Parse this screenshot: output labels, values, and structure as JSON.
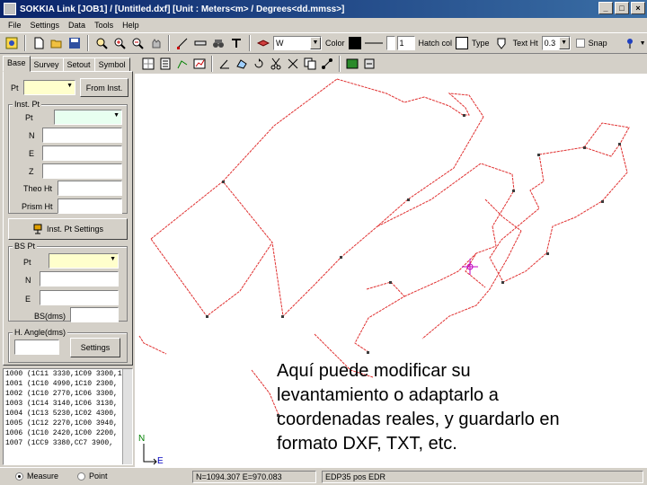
{
  "window": {
    "title": "SOKKIA Link  [JOB1] / [Untitled.dxf]  [Unit : Meters<m> / Degrees<dd.mmss>]",
    "buttons": [
      "_",
      "□",
      "×"
    ]
  },
  "menu": [
    "File",
    "Settings",
    "Data",
    "Tools",
    "Help"
  ],
  "toolbar": {
    "layer_value": "W",
    "color_label": "Color",
    "line_width_value": "1",
    "hatch_label": "Hatch col",
    "type_label": "Type",
    "text_ht_label": "Text Ht",
    "text_ht_value": "0.3",
    "snap_label": "Snap",
    "colors": {
      "color_swatch": "#000000",
      "hatch_swatch": "#ffffff"
    }
  },
  "tabs": [
    "Base",
    "Survey",
    "Setout",
    "Symbol"
  ],
  "panel": {
    "pt_label": "Pt",
    "from_inst_button": "From Inst.",
    "inst_pt_group": "Inst. Pt",
    "inst_pt_label": "Pt",
    "n_label": "N",
    "e_label": "E",
    "z_label": "Z",
    "theo_ht_label": "Theo Ht",
    "prism_ht_label": "Prism Ht",
    "inst_pt_settings_button": "Inst. Pt Settings",
    "bs_pt_group": "BS Pt",
    "bs_pt_label": "Pt",
    "bs_n_label": "N",
    "bs_e_label": "E",
    "bs_dms_label": "BS(dms)",
    "h_angle_group": "H. Angle(dms)",
    "settings_button": "Settings"
  },
  "point_list": [
    "1000  (1C11 3330,1C09 3300,1",
    "1001  (1C10 4990,1C10 2300,",
    "1002  (1C10 2770,1C06 3300,",
    "1003  (1C14 3140,1C06 3130,",
    "1004  (1C13 5230,1C02 4300,",
    "1005  (1C12 2270,1C00 3940,",
    "1006  (1C10 2420,1C00 2200,",
    "1007  (1CC9 3380,CC7 3900,"
  ],
  "axes": {
    "north": "N",
    "east": "E"
  },
  "overlay": {
    "line1": "Aquí puede modificar su",
    "line2": "levantamiento o adaptarlo a",
    "line3": "coordenadas reales, y guardarlo en",
    "line4": "formato DXF, TXT, etc."
  },
  "status": {
    "measure_label": "Measure",
    "point_label": "Point",
    "coords": "N=1094.307  E=970.083",
    "mode": "EDP35 pos EDR"
  },
  "drawing": {
    "line_color": "#e03030",
    "point_color": "#3c3c3c",
    "cursor_color": "#c000c0"
  }
}
